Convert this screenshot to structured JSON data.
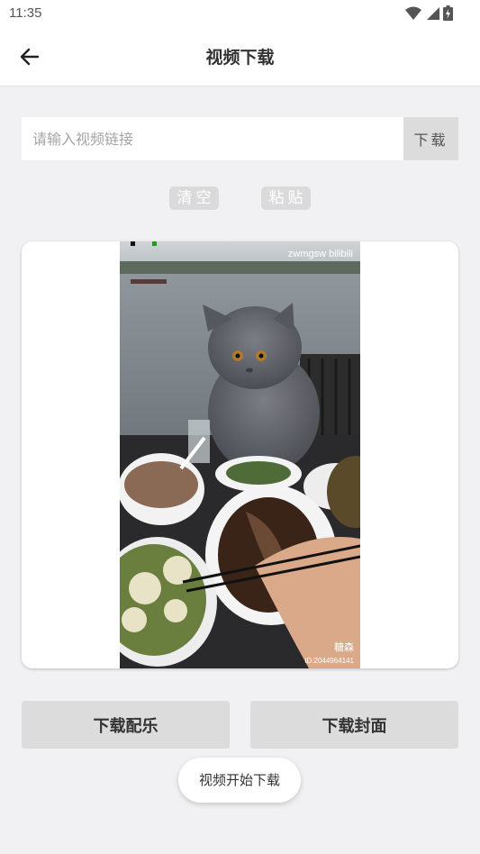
{
  "status_bar": {
    "time": "11:35",
    "icons": [
      "wifi-icon",
      "signal-icon",
      "battery-icon"
    ]
  },
  "app_bar": {
    "back_icon": "arrow-left-icon",
    "title": "视频下载"
  },
  "url_input": {
    "value": "",
    "placeholder": "请输入视频链接"
  },
  "download_button": {
    "label": "下载"
  },
  "chips": {
    "clear_label": "清空",
    "paste_label": "粘贴"
  },
  "video_preview": {
    "watermark_top": "zwmgsw bilibili",
    "watermark_bottom": "糖森",
    "watermark_id": "ID:2044964141"
  },
  "actions": {
    "download_music_label": "下载配乐",
    "download_cover_label": "下载封面"
  },
  "toast": {
    "text": "视频开始下载"
  },
  "colors": {
    "background": "#f1f1f3",
    "button_gray": "#dcdcdc",
    "chip_gray": "#dadada"
  }
}
